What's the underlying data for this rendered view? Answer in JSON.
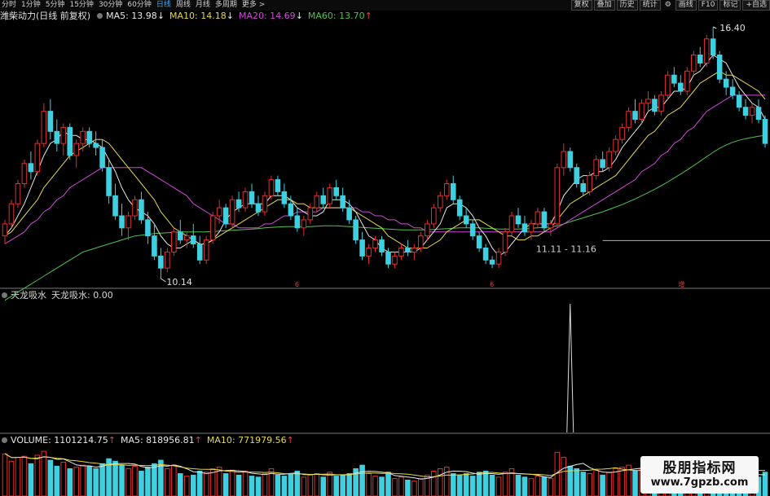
{
  "toolbar": {
    "periods": [
      "分时",
      "1分钟",
      "5分钟",
      "15分钟",
      "30分钟",
      "60分钟",
      "日线",
      "周线",
      "月线",
      "多周期",
      "更多 >"
    ],
    "active_index": 6,
    "right_buttons": [
      "复权",
      "叠加",
      "历史",
      "统计",
      "画线",
      "F10",
      "标记",
      "+自选"
    ],
    "settings_icon": "gear-icon"
  },
  "main_legend": {
    "title": "潍柴动力(日线 前复权)",
    "ma5": "MA5: 13.98",
    "ma5_arrow": "↓",
    "ma10": "MA10: 14.18",
    "ma10_arrow": "↓",
    "ma20": "MA20: 14.69",
    "ma20_arrow": "↓",
    "ma60": "MA60: 13.70",
    "ma60_arrow": "↑"
  },
  "annotations": {
    "high_label": "16.40",
    "low_label": "10.14",
    "range_label": "11.11 - 11.16",
    "markers": [
      "6",
      "6",
      "增"
    ]
  },
  "indicator_legend": {
    "name": "天龙吸水",
    "value_text": "天龙吸水: 0.00"
  },
  "volume_legend": {
    "volume": "VOLUME: 1101214.75",
    "volume_arrow": "↑",
    "ma5": "MA5: 818956.81",
    "ma5_arrow": "↑",
    "ma10": "MA10: 771979.56",
    "ma10_arrow": "↑"
  },
  "watermark": {
    "line1": "股朋指标网",
    "line2": "www.7gpzb.com"
  },
  "colors": {
    "up": "#e03030",
    "down": "#3fd0e0",
    "ma5": "#e8e8e8",
    "ma10": "#e6d84a",
    "ma20": "#d04ad8",
    "ma60": "#4fc24f",
    "spike": "#dcdcdc"
  },
  "chart_data": {
    "type": "candlestick",
    "title": "潍柴动力(日线 前复权)",
    "price_range": [
      10.14,
      16.4
    ],
    "candles": [
      [
        11.2,
        11.6,
        11.0,
        11.5
      ],
      [
        11.5,
        12.1,
        11.4,
        12.0
      ],
      [
        12.0,
        12.6,
        11.9,
        12.5
      ],
      [
        12.5,
        13.1,
        12.4,
        13.0
      ],
      [
        13.0,
        13.3,
        12.6,
        12.8
      ],
      [
        12.8,
        13.6,
        12.7,
        13.5
      ],
      [
        13.5,
        14.5,
        13.4,
        14.3
      ],
      [
        14.3,
        14.6,
        13.6,
        13.8
      ],
      [
        13.8,
        14.1,
        13.3,
        13.5
      ],
      [
        13.5,
        14.0,
        13.2,
        13.9
      ],
      [
        13.9,
        14.0,
        13.1,
        13.2
      ],
      [
        13.2,
        13.6,
        12.9,
        13.5
      ],
      [
        13.5,
        13.9,
        13.3,
        13.8
      ],
      [
        13.8,
        13.9,
        13.4,
        13.5
      ],
      [
        13.5,
        13.8,
        13.2,
        13.4
      ],
      [
        13.4,
        13.6,
        12.8,
        12.9
      ],
      [
        12.9,
        13.1,
        12.0,
        12.2
      ],
      [
        12.2,
        12.5,
        11.6,
        11.7
      ],
      [
        11.7,
        12.0,
        11.2,
        11.4
      ],
      [
        11.4,
        11.8,
        11.1,
        11.7
      ],
      [
        11.7,
        12.2,
        11.6,
        12.1
      ],
      [
        12.1,
        12.3,
        11.5,
        11.6
      ],
      [
        11.6,
        11.8,
        11.0,
        11.2
      ],
      [
        11.2,
        11.5,
        10.6,
        10.7
      ],
      [
        10.7,
        10.9,
        10.14,
        10.4
      ],
      [
        10.4,
        10.9,
        10.3,
        10.8
      ],
      [
        10.8,
        11.4,
        10.7,
        11.3
      ],
      [
        11.3,
        11.6,
        11.0,
        11.1
      ],
      [
        11.1,
        11.3,
        10.9,
        11.2
      ],
      [
        11.2,
        11.5,
        10.9,
        11.0
      ],
      [
        11.0,
        11.2,
        10.5,
        10.6
      ],
      [
        10.6,
        11.2,
        10.5,
        11.1
      ],
      [
        11.1,
        11.8,
        11.0,
        11.7
      ],
      [
        11.7,
        12.1,
        11.5,
        11.9
      ],
      [
        11.9,
        12.0,
        11.4,
        11.5
      ],
      [
        11.5,
        12.2,
        11.4,
        12.1
      ],
      [
        12.1,
        12.3,
        11.8,
        11.9
      ],
      [
        11.9,
        12.4,
        11.8,
        12.3
      ],
      [
        12.3,
        12.5,
        11.9,
        12.0
      ],
      [
        12.0,
        12.2,
        11.7,
        11.8
      ],
      [
        11.8,
        12.3,
        11.7,
        12.2
      ],
      [
        12.2,
        12.7,
        12.1,
        12.6
      ],
      [
        12.6,
        12.7,
        12.2,
        12.3
      ],
      [
        12.3,
        12.5,
        11.9,
        12.0
      ],
      [
        12.0,
        12.2,
        11.6,
        11.7
      ],
      [
        11.7,
        11.9,
        11.3,
        11.4
      ],
      [
        11.4,
        11.7,
        11.2,
        11.6
      ],
      [
        11.6,
        12.0,
        11.5,
        11.9
      ],
      [
        11.9,
        12.3,
        11.8,
        12.2
      ],
      [
        12.2,
        12.4,
        11.9,
        12.0
      ],
      [
        12.0,
        12.5,
        11.9,
        12.4
      ],
      [
        12.4,
        12.6,
        12.1,
        12.2
      ],
      [
        12.2,
        12.4,
        11.8,
        11.9
      ],
      [
        11.9,
        12.1,
        11.5,
        11.6
      ],
      [
        11.6,
        11.7,
        11.0,
        11.1
      ],
      [
        11.1,
        11.3,
        10.6,
        10.7
      ],
      [
        10.7,
        11.0,
        10.5,
        10.9
      ],
      [
        10.9,
        11.2,
        10.8,
        11.1
      ],
      [
        11.1,
        11.2,
        10.7,
        10.8
      ],
      [
        10.8,
        10.9,
        10.4,
        10.5
      ],
      [
        10.5,
        10.8,
        10.4,
        10.7
      ],
      [
        10.7,
        11.0,
        10.6,
        10.9
      ],
      [
        10.9,
        11.1,
        10.7,
        10.8
      ],
      [
        10.8,
        11.0,
        10.6,
        10.9
      ],
      [
        10.9,
        11.3,
        10.8,
        11.2
      ],
      [
        11.2,
        11.6,
        11.1,
        11.5
      ],
      [
        11.5,
        12.0,
        11.4,
        11.9
      ],
      [
        11.9,
        12.3,
        11.8,
        12.2
      ],
      [
        12.2,
        12.6,
        12.1,
        12.5
      ],
      [
        12.5,
        12.7,
        12.0,
        12.1
      ],
      [
        12.1,
        12.2,
        11.6,
        11.7
      ],
      [
        11.7,
        11.9,
        11.4,
        11.5
      ],
      [
        11.5,
        11.6,
        11.1,
        11.2
      ],
      [
        11.2,
        11.3,
        10.8,
        10.9
      ],
      [
        10.9,
        11.0,
        10.5,
        10.6
      ],
      [
        10.6,
        10.7,
        10.4,
        10.5
      ],
      [
        10.5,
        10.9,
        10.4,
        10.8
      ],
      [
        10.8,
        11.4,
        10.7,
        11.3
      ],
      [
        11.3,
        11.8,
        11.2,
        11.7
      ],
      [
        11.7,
        11.9,
        11.4,
        11.5
      ],
      [
        11.5,
        11.7,
        11.2,
        11.3
      ],
      [
        11.3,
        11.6,
        11.1,
        11.5
      ],
      [
        11.5,
        11.9,
        11.4,
        11.8
      ],
      [
        11.8,
        11.9,
        11.3,
        11.4
      ],
      [
        11.4,
        11.6,
        11.2,
        11.5
      ],
      [
        11.5,
        13.0,
        11.4,
        12.9
      ],
      [
        12.9,
        13.5,
        12.7,
        13.3
      ],
      [
        13.3,
        13.4,
        12.8,
        12.9
      ],
      [
        12.9,
        13.0,
        12.4,
        12.5
      ],
      [
        12.5,
        12.6,
        12.2,
        12.3
      ],
      [
        12.3,
        12.8,
        12.2,
        12.7
      ],
      [
        12.7,
        13.2,
        12.6,
        13.1
      ],
      [
        13.1,
        13.3,
        12.8,
        12.9
      ],
      [
        12.9,
        13.4,
        12.8,
        13.3
      ],
      [
        13.3,
        13.7,
        13.2,
        13.6
      ],
      [
        13.6,
        14.0,
        13.5,
        13.9
      ],
      [
        13.9,
        14.4,
        13.8,
        14.3
      ],
      [
        14.3,
        14.6,
        14.0,
        14.1
      ],
      [
        14.1,
        14.6,
        14.0,
        14.5
      ],
      [
        14.5,
        14.8,
        14.3,
        14.6
      ],
      [
        14.6,
        14.7,
        14.2,
        14.3
      ],
      [
        14.3,
        14.8,
        14.2,
        14.7
      ],
      [
        14.7,
        15.3,
        14.6,
        15.2
      ],
      [
        15.2,
        15.4,
        14.9,
        15.0
      ],
      [
        15.0,
        15.2,
        14.7,
        14.8
      ],
      [
        14.8,
        15.4,
        14.7,
        15.3
      ],
      [
        15.3,
        15.8,
        15.2,
        15.7
      ],
      [
        15.7,
        15.9,
        15.4,
        15.5
      ],
      [
        15.5,
        16.2,
        15.4,
        16.1
      ],
      [
        16.1,
        16.4,
        15.6,
        15.7
      ],
      [
        15.7,
        15.8,
        15.0,
        15.1
      ],
      [
        15.1,
        15.3,
        14.7,
        14.9
      ],
      [
        14.9,
        15.1,
        14.6,
        14.7
      ],
      [
        14.7,
        14.8,
        14.3,
        14.4
      ],
      [
        14.4,
        14.6,
        14.1,
        14.2
      ],
      [
        14.2,
        14.5,
        14.0,
        14.4
      ],
      [
        14.4,
        14.6,
        14.0,
        14.1
      ],
      [
        14.1,
        14.2,
        13.4,
        13.5
      ]
    ],
    "ma5": [
      11.2,
      11.4,
      11.7,
      12.0,
      12.4,
      12.8,
      13.2,
      13.5,
      13.6,
      13.8,
      13.7,
      13.7,
      13.6,
      13.6,
      13.5,
      13.4,
      13.1,
      12.8,
      12.4,
      12.1,
      11.9,
      11.8,
      11.7,
      11.5,
      11.2,
      11.0,
      10.9,
      10.9,
      11.0,
      11.1,
      11.0,
      11.0,
      11.1,
      11.3,
      11.6,
      11.8,
      11.9,
      12.0,
      12.0,
      12.0,
      12.0,
      12.2,
      12.2,
      12.2,
      12.1,
      11.9,
      11.8,
      11.7,
      11.7,
      11.8,
      12.1,
      12.1,
      12.1,
      12.0,
      11.8,
      11.5,
      11.2,
      11.1,
      10.9,
      10.8,
      10.8,
      10.8,
      10.8,
      10.8,
      10.9,
      11.1,
      11.3,
      11.5,
      11.9,
      12.0,
      12.0,
      11.9,
      11.7,
      11.4,
      11.2,
      10.9,
      10.7,
      10.8,
      11.0,
      11.2,
      11.4,
      11.5,
      11.5,
      11.5,
      11.5,
      11.8,
      12.2,
      12.4,
      12.6,
      12.7,
      12.7,
      12.8,
      12.8,
      12.9,
      13.1,
      13.4,
      13.6,
      13.8,
      14.0,
      14.3,
      14.4,
      14.4,
      14.6,
      14.8,
      14.8,
      14.9,
      15.2,
      15.3,
      15.5,
      15.7,
      15.6,
      15.5,
      15.2,
      14.9,
      14.7,
      14.5,
      14.4,
      14.1
    ],
    "ma10": [
      11.2,
      11.3,
      11.5,
      11.7,
      11.9,
      12.1,
      12.4,
      12.6,
      12.8,
      13.0,
      13.2,
      13.3,
      13.4,
      13.5,
      13.6,
      13.6,
      13.5,
      13.3,
      13.1,
      12.9,
      12.7,
      12.5,
      12.3,
      12.1,
      11.8,
      11.6,
      11.4,
      11.3,
      11.2,
      11.1,
      11.0,
      11.0,
      11.1,
      11.2,
      11.3,
      11.4,
      11.5,
      11.6,
      11.7,
      11.8,
      11.9,
      12.0,
      12.1,
      12.1,
      12.1,
      12.0,
      12.0,
      11.9,
      11.9,
      11.9,
      11.9,
      11.9,
      11.9,
      11.9,
      11.8,
      11.7,
      11.6,
      11.5,
      11.4,
      11.2,
      11.1,
      11.0,
      10.9,
      10.9,
      10.9,
      10.9,
      11.0,
      11.1,
      11.3,
      11.4,
      11.5,
      11.6,
      11.6,
      11.6,
      11.5,
      11.4,
      11.3,
      11.2,
      11.2,
      11.1,
      11.1,
      11.2,
      11.2,
      11.3,
      11.4,
      11.6,
      11.8,
      12.0,
      12.1,
      12.2,
      12.3,
      12.4,
      12.5,
      12.6,
      12.7,
      12.9,
      13.1,
      13.3,
      13.5,
      13.7,
      13.8,
      14.0,
      14.2,
      14.3,
      14.4,
      14.6,
      14.8,
      15.0,
      15.1,
      15.2,
      15.3,
      15.2,
      15.2,
      15.1,
      15.0,
      14.9,
      14.8,
      14.6
    ],
    "ma20": [
      11.0,
      11.1,
      11.2,
      11.3,
      11.5,
      11.6,
      11.8,
      11.9,
      12.1,
      12.2,
      12.4,
      12.5,
      12.6,
      12.7,
      12.8,
      12.9,
      12.9,
      12.9,
      12.9,
      12.9,
      12.9,
      12.9,
      12.8,
      12.7,
      12.6,
      12.5,
      12.4,
      12.3,
      12.2,
      12.0,
      11.9,
      11.8,
      11.7,
      11.6,
      11.5,
      11.5,
      11.4,
      11.4,
      11.4,
      11.4,
      11.5,
      11.5,
      11.6,
      11.7,
      11.7,
      11.8,
      11.8,
      11.8,
      11.8,
      11.9,
      11.9,
      11.9,
      11.9,
      11.9,
      11.9,
      11.8,
      11.8,
      11.7,
      11.7,
      11.6,
      11.6,
      11.5,
      11.5,
      11.4,
      11.4,
      11.3,
      11.3,
      11.3,
      11.3,
      11.3,
      11.3,
      11.3,
      11.3,
      11.3,
      11.3,
      11.3,
      11.3,
      11.3,
      11.3,
      11.3,
      11.3,
      11.3,
      11.3,
      11.3,
      11.3,
      11.4,
      11.5,
      11.6,
      11.7,
      11.8,
      11.9,
      12.0,
      12.1,
      12.2,
      12.3,
      12.4,
      12.5,
      12.6,
      12.8,
      12.9,
      13.0,
      13.2,
      13.3,
      13.5,
      13.6,
      13.8,
      13.9,
      14.1,
      14.3,
      14.4,
      14.5,
      14.6,
      14.7,
      14.7,
      14.7,
      14.7,
      14.7,
      14.7
    ],
    "ma60": [
      9.6,
      9.7,
      9.8,
      9.9,
      10.0,
      10.1,
      10.2,
      10.3,
      10.4,
      10.5,
      10.6,
      10.7,
      10.8,
      10.85,
      10.9,
      10.95,
      11.0,
      11.05,
      11.1,
      11.15,
      11.2,
      11.22,
      11.24,
      11.26,
      11.27,
      11.28,
      11.29,
      11.3,
      11.3,
      11.3,
      11.3,
      11.3,
      11.31,
      11.32,
      11.33,
      11.34,
      11.35,
      11.36,
      11.37,
      11.38,
      11.4,
      11.41,
      11.42,
      11.43,
      11.43,
      11.43,
      11.43,
      11.43,
      11.44,
      11.45,
      11.45,
      11.45,
      11.44,
      11.43,
      11.42,
      11.41,
      11.4,
      11.39,
      11.38,
      11.37,
      11.36,
      11.35,
      11.35,
      11.35,
      11.35,
      11.35,
      11.36,
      11.37,
      11.38,
      11.39,
      11.4,
      11.4,
      11.4,
      11.4,
      11.39,
      11.38,
      11.37,
      11.37,
      11.37,
      11.37,
      11.38,
      11.39,
      11.4,
      11.41,
      11.42,
      11.45,
      11.5,
      11.55,
      11.6,
      11.65,
      11.7,
      11.75,
      11.8,
      11.86,
      11.92,
      11.98,
      12.05,
      12.12,
      12.2,
      12.28,
      12.36,
      12.45,
      12.54,
      12.64,
      12.74,
      12.84,
      12.95,
      13.06,
      13.17,
      13.28,
      13.38,
      13.46,
      13.53,
      13.58,
      13.62,
      13.65,
      13.68,
      13.7
    ],
    "spike_index": 87,
    "volumes": [
      0.85,
      0.7,
      0.78,
      0.8,
      0.65,
      0.82,
      0.9,
      0.72,
      0.6,
      0.68,
      0.55,
      0.58,
      0.62,
      0.6,
      0.55,
      0.65,
      0.75,
      0.7,
      0.62,
      0.55,
      0.6,
      0.5,
      0.58,
      0.65,
      0.72,
      0.55,
      0.62,
      0.45,
      0.4,
      0.42,
      0.5,
      0.48,
      0.55,
      0.58,
      0.45,
      0.52,
      0.42,
      0.5,
      0.4,
      0.38,
      0.45,
      0.55,
      0.42,
      0.4,
      0.45,
      0.5,
      0.38,
      0.42,
      0.45,
      0.38,
      0.48,
      0.4,
      0.42,
      0.45,
      0.55,
      0.62,
      0.45,
      0.4,
      0.38,
      0.48,
      0.35,
      0.38,
      0.32,
      0.3,
      0.35,
      0.42,
      0.5,
      0.55,
      0.58,
      0.45,
      0.42,
      0.45,
      0.4,
      0.48,
      0.5,
      0.42,
      0.38,
      0.48,
      0.55,
      0.42,
      0.38,
      0.35,
      0.4,
      0.38,
      0.35,
      0.88,
      0.78,
      0.6,
      0.55,
      0.48,
      0.45,
      0.52,
      0.42,
      0.48,
      0.55,
      0.58,
      0.62,
      0.5,
      0.55,
      0.52,
      0.45,
      0.5,
      0.62,
      0.48,
      0.45,
      0.55,
      0.6,
      0.48,
      0.62,
      0.7,
      0.65,
      0.55,
      0.5,
      0.45,
      0.42,
      0.4,
      0.38,
      0.48
    ]
  }
}
